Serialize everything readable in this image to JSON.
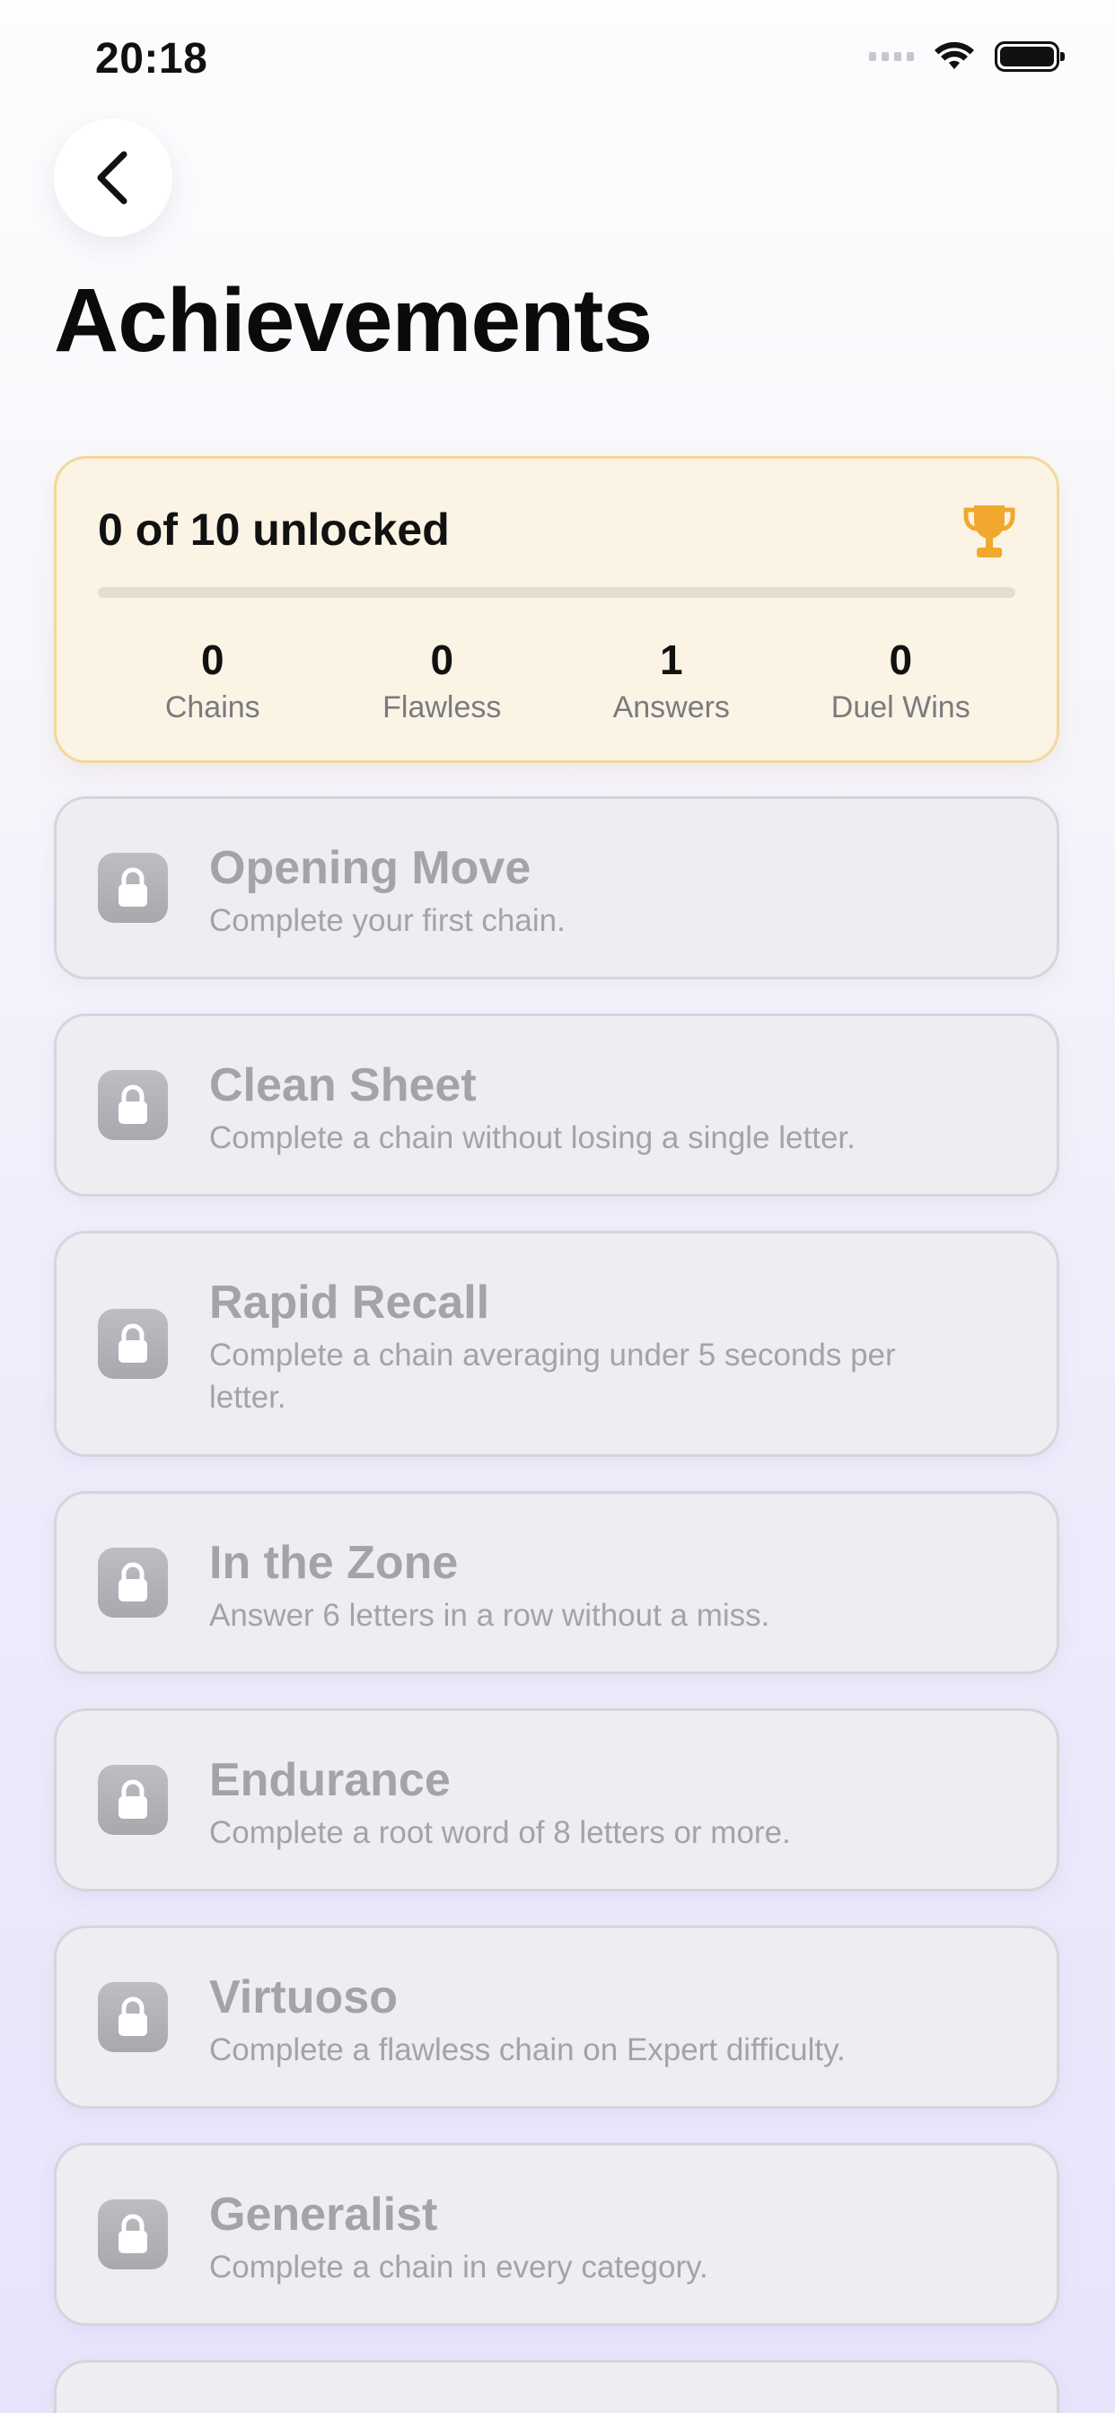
{
  "status_bar": {
    "time": "20:18"
  },
  "header": {
    "title": "Achievements"
  },
  "summary": {
    "title": "0 of 10 unlocked",
    "unlocked": 0,
    "total": 10,
    "progress_fraction": 0.0,
    "stats": [
      {
        "value": "0",
        "label": "Chains"
      },
      {
        "value": "0",
        "label": "Flawless"
      },
      {
        "value": "1",
        "label": "Answers"
      },
      {
        "value": "0",
        "label": "Duel Wins"
      }
    ]
  },
  "achievements": [
    {
      "title": "Opening Move",
      "description": "Complete your first chain.",
      "locked": true
    },
    {
      "title": "Clean Sheet",
      "description": "Complete a chain without losing a single letter.",
      "locked": true
    },
    {
      "title": "Rapid Recall",
      "description": "Complete a chain averaging under 5 seconds per letter.",
      "locked": true
    },
    {
      "title": "In the Zone",
      "description": "Answer 6 letters in a row without a miss.",
      "locked": true
    },
    {
      "title": "Endurance",
      "description": "Complete a root word of 8 letters or more.",
      "locked": true
    },
    {
      "title": "Virtuoso",
      "description": "Complete a flawless chain on Expert difficulty.",
      "locked": true
    },
    {
      "title": "Generalist",
      "description": "Complete a chain in every category.",
      "locked": true
    }
  ],
  "icons": {
    "back": "chevron-left-icon",
    "trophy": "trophy-icon",
    "lock": "lock-icon"
  },
  "colors": {
    "accent": "#f0a92e",
    "card_locked": "#eeedf2",
    "summary_bg": "#fbf3e4"
  }
}
